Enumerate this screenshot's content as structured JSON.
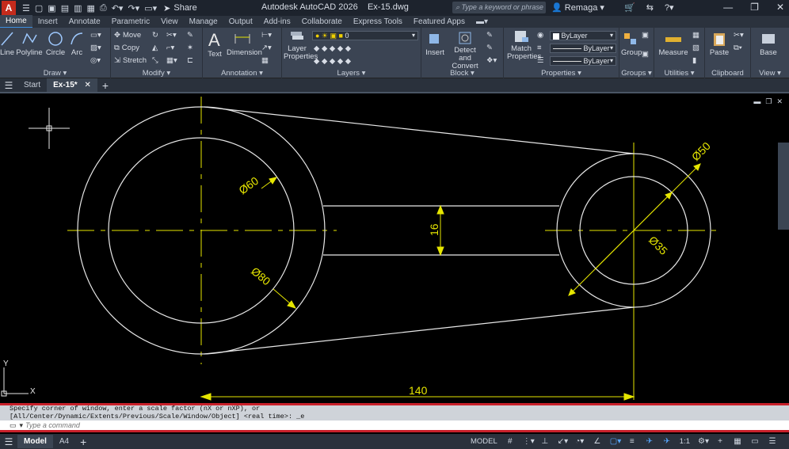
{
  "titlebar": {
    "app_name": "Autodesk AutoCAD 2026",
    "file_name": "Ex-15.dwg",
    "share_label": "Share",
    "search_placeholder": "Type a keyword or phrase",
    "user_name": "Remaga"
  },
  "ribbon": {
    "tabs": [
      "Home",
      "Insert",
      "Annotate",
      "Parametric",
      "View",
      "Manage",
      "Output",
      "Add-ins",
      "Collaborate",
      "Express Tools",
      "Featured Apps"
    ],
    "active_tab": "Home",
    "panels": {
      "draw": {
        "title": "Draw",
        "tools": [
          "Line",
          "Polyline",
          "Circle",
          "Arc"
        ]
      },
      "modify": {
        "title": "Modify",
        "tools": [
          "Move",
          "Copy",
          "Stretch"
        ]
      },
      "annotation": {
        "title": "Annotation",
        "tools": [
          "Text",
          "Dimension"
        ]
      },
      "layers": {
        "title": "Layers",
        "layer_properties": "Layer Properties",
        "current_layer": "0"
      },
      "block": {
        "title": "Block",
        "tools": [
          "Insert",
          "Detect and Convert"
        ]
      },
      "properties": {
        "title": "Properties",
        "match_properties": "Match Properties",
        "color": "ByLayer",
        "linetype": "ByLayer",
        "lineweight": "ByLayer"
      },
      "groups": {
        "title": "Groups",
        "tool": "Group"
      },
      "utilities": {
        "title": "Utilities",
        "tool": "Measure"
      },
      "clipboard": {
        "title": "Clipboard",
        "tool": "Paste"
      },
      "view": {
        "title": "View",
        "tool": "Base"
      }
    }
  },
  "file_tabs": {
    "tabs": [
      "Start",
      "Ex-15*"
    ],
    "active_tab": "Ex-15*"
  },
  "drawing": {
    "dimensions": {
      "big_outer_diameter": "Ø80",
      "big_inner_diameter": "Ø60",
      "small_outer_diameter": "Ø50",
      "small_inner_diameter": "Ø35",
      "link_width": "16",
      "center_distance": "140"
    },
    "ucs": {
      "x_label": "X",
      "y_label": "Y"
    },
    "colors": {
      "geometry": "#e8e8e8",
      "dimension": "#e6e600",
      "centerline": "#e6e600",
      "background": "#000000"
    }
  },
  "command": {
    "history_line_1": "Specify corner of window, enter a scale factor (nX or nXP), or",
    "history_line_2": "[All/Center/Dynamic/Extents/Previous/Scale/Window/Object] <real time>: _e",
    "input_placeholder": "Type a command"
  },
  "statusbar": {
    "layout_tabs": [
      "Model",
      "A4"
    ],
    "active_layout": "Model",
    "model_label": "MODEL",
    "scale_label": "1:1"
  }
}
